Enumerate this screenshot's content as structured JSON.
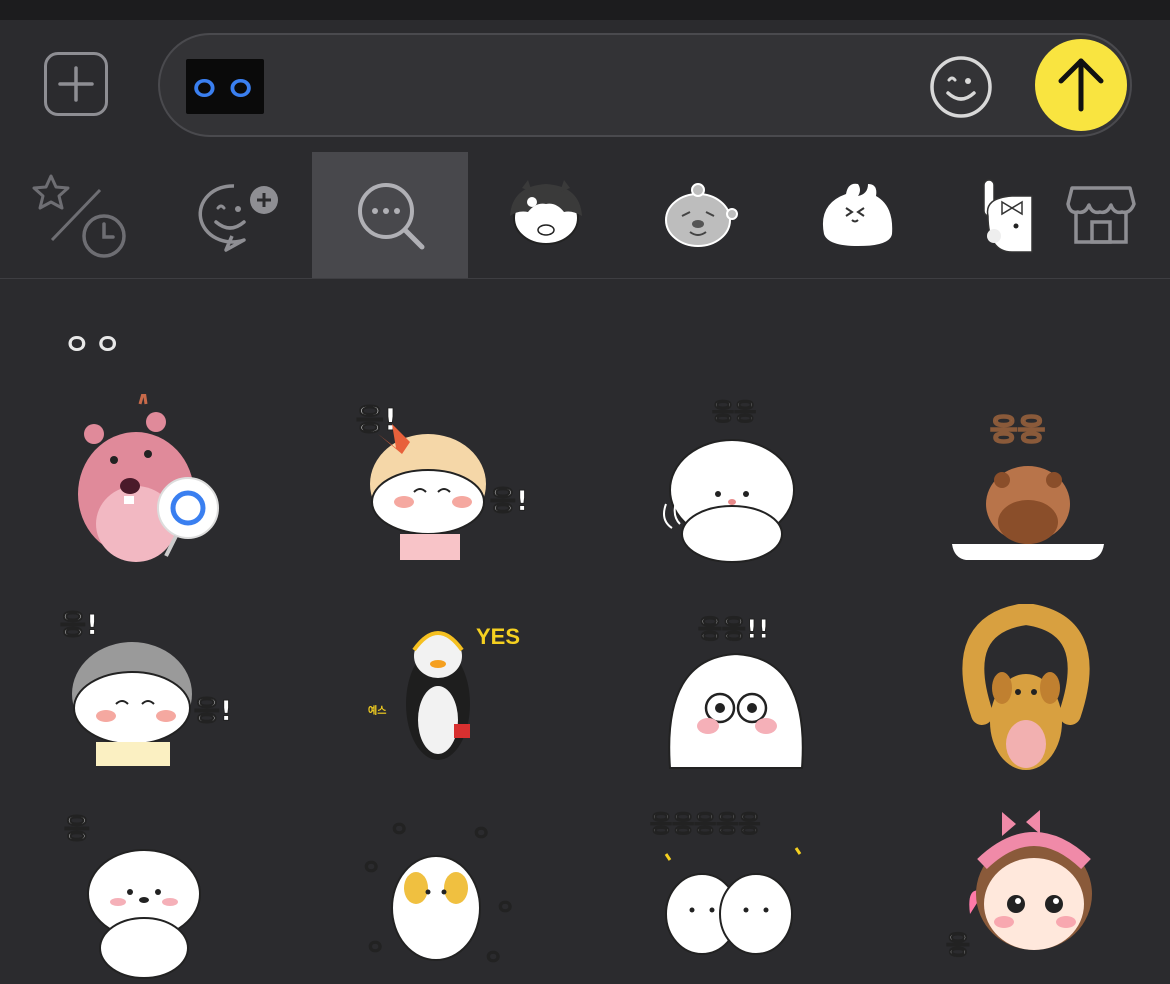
{
  "input": {
    "typed_text": "ㅇㅇ",
    "buttons": [
      "plus-icon",
      "emoji-icon",
      "arrow-up-icon"
    ],
    "send_color": "#f9e440"
  },
  "tabs": [
    {
      "name": "recent-favorites",
      "icon": "star-clock-icon"
    },
    {
      "name": "add-emoticon",
      "icon": "chat-face-plus-icon"
    },
    {
      "name": "search",
      "icon": "search-bubble-icon",
      "active": true
    },
    {
      "name": "pack-girl",
      "icon": "girl-sticker-icon"
    },
    {
      "name": "pack-bear",
      "icon": "bear-sticker-icon"
    },
    {
      "name": "pack-bunny",
      "icon": "bunny-sticker-icon"
    },
    {
      "name": "pack-rabbit-bow",
      "icon": "rabbit-bow-sticker-icon"
    },
    {
      "name": "store",
      "icon": "store-icon"
    }
  ],
  "results": {
    "query": "ㅇㅇ",
    "stickers": [
      {
        "name": "beaver-o-sign",
        "text": ""
      },
      {
        "name": "girl-bow-ung",
        "text": "응!"
      },
      {
        "name": "poodle-ungung",
        "text": "응응"
      },
      {
        "name": "squirrel-ungung",
        "text": "응응"
      },
      {
        "name": "boy-ung",
        "text": "응!"
      },
      {
        "name": "penguin-yes",
        "text": "YES",
        "subtext": "예스"
      },
      {
        "name": "blob-ungung",
        "text": "응응!!"
      },
      {
        "name": "puppy-arms",
        "text": ""
      },
      {
        "name": "white-dog-ung",
        "text": "응"
      },
      {
        "name": "bunny-ung",
        "text": "ㅇㅇ"
      },
      {
        "name": "bears-ung-row",
        "text": "응응응응응"
      },
      {
        "name": "girl-headband",
        "text": "응"
      }
    ]
  }
}
